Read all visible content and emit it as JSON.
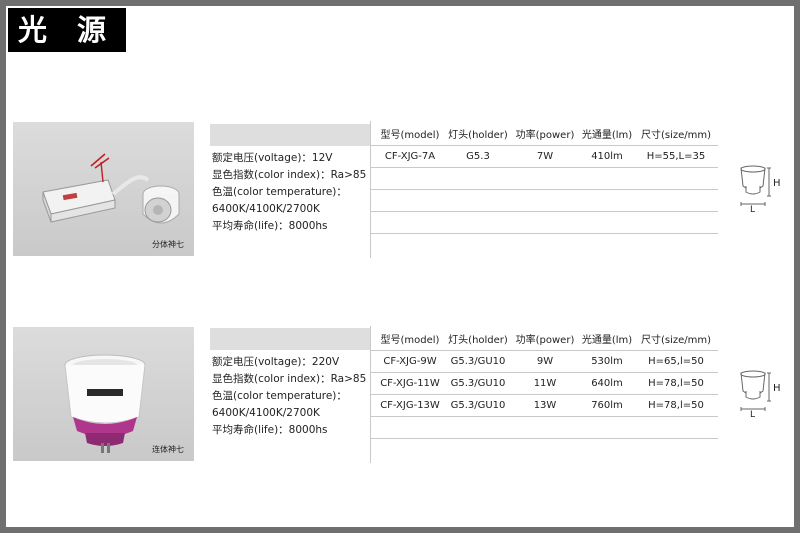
{
  "page_title": "光 源",
  "products": [
    {
      "photo_caption": "分体神七",
      "specs": [
        "额定电压(voltage)：12V",
        "显色指数(color index)：Ra>85",
        "色温(color temperature)：",
        "6400K/4100K/2700K",
        "平均寿命(life)：8000hs"
      ],
      "table_header": [
        "型号(model)",
        "灯头(holder)",
        "功率(power)",
        "光通量(lm)",
        "尺寸(size/mm)"
      ],
      "rows": [
        [
          "CF-XJG-7A",
          "G5.3",
          "7W",
          "410lm",
          "H=55,L=35"
        ],
        [
          "",
          "",
          "",
          "",
          ""
        ],
        [
          "",
          "",
          "",
          "",
          ""
        ],
        [
          "",
          "",
          "",
          "",
          ""
        ],
        [
          "",
          "",
          "",
          "",
          ""
        ]
      ],
      "diagram_labels": {
        "h": "H",
        "l": "L"
      }
    },
    {
      "photo_caption": "连体神七",
      "specs": [
        "额定电压(voltage)：220V",
        "显色指数(color index)：Ra>85",
        "色温(color temperature)：",
        "6400K/4100K/2700K",
        "平均寿命(life)：8000hs"
      ],
      "table_header": [
        "型号(model)",
        "灯头(holder)",
        "功率(power)",
        "光通量(lm)",
        "尺寸(size/mm)"
      ],
      "rows": [
        [
          "CF-XJG-9W",
          "G5.3/GU10",
          "9W",
          "530lm",
          "H=65,l=50"
        ],
        [
          "CF-XJG-11W",
          "G5.3/GU10",
          "11W",
          "640lm",
          "H=78,l=50"
        ],
        [
          "CF-XJG-13W",
          "G5.3/GU10",
          "13W",
          "760lm",
          "H=78,l=50"
        ],
        [
          "",
          "",
          "",
          "",
          ""
        ],
        [
          "",
          "",
          "",
          "",
          ""
        ]
      ],
      "diagram_labels": {
        "h": "H",
        "l": "L"
      }
    }
  ]
}
